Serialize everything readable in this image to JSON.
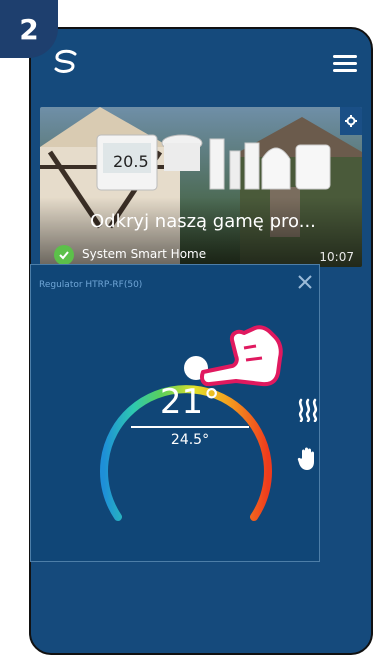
{
  "step": {
    "number": "2"
  },
  "app": {
    "logo": "salus-logo",
    "menu_icon": "hamburger-menu-icon"
  },
  "banner": {
    "title": "Odkryj naszą gamę pro...",
    "thermostat_display": "20.5",
    "brand": "System Smart Home",
    "time": "10:07",
    "check_icon": "check-circle-icon",
    "settings_icon": "gear-icon"
  },
  "device": {
    "name": "Regulator HTRP-RF(50)",
    "set_temperature": "21°",
    "current_temperature": "24.5°",
    "heating_icon": "heat-waves-icon",
    "mode_icon": "hand-manual-icon",
    "close_icon": "close-icon"
  },
  "colors": {
    "background": "#154a7c",
    "widget": "#104677",
    "accent_green": "#5cc04a",
    "pointer_hand": "#e0195f"
  }
}
